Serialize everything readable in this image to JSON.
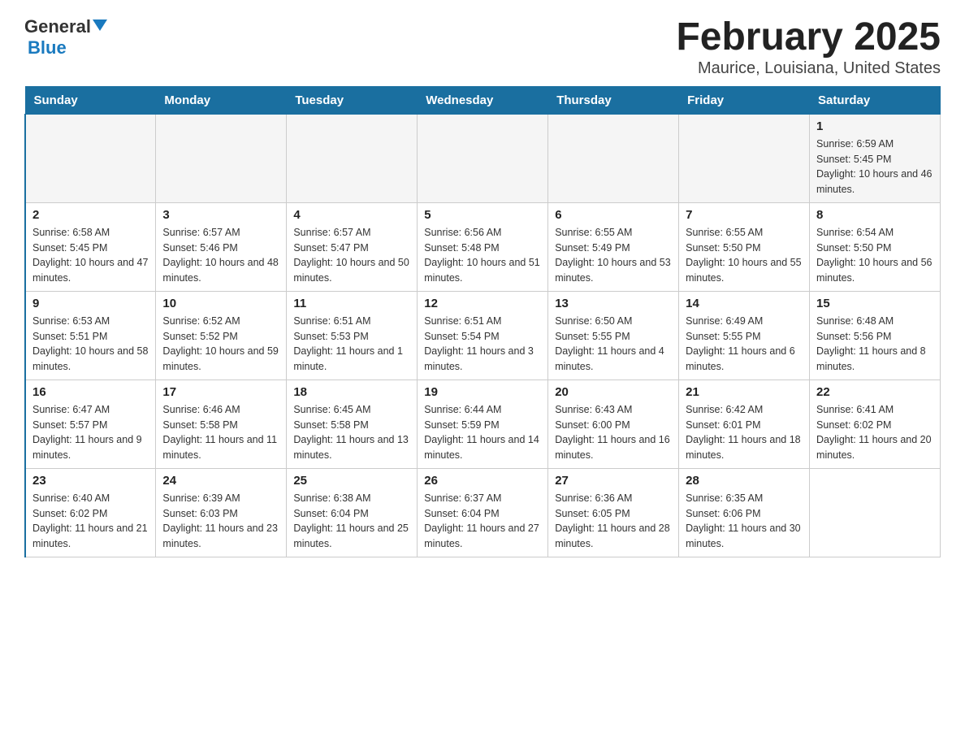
{
  "header": {
    "logo_general": "General",
    "logo_blue": "Blue",
    "title": "February 2025",
    "subtitle": "Maurice, Louisiana, United States"
  },
  "days_of_week": [
    "Sunday",
    "Monday",
    "Tuesday",
    "Wednesday",
    "Thursday",
    "Friday",
    "Saturday"
  ],
  "weeks": [
    [
      {
        "day": "",
        "detail": ""
      },
      {
        "day": "",
        "detail": ""
      },
      {
        "day": "",
        "detail": ""
      },
      {
        "day": "",
        "detail": ""
      },
      {
        "day": "",
        "detail": ""
      },
      {
        "day": "",
        "detail": ""
      },
      {
        "day": "1",
        "detail": "Sunrise: 6:59 AM\nSunset: 5:45 PM\nDaylight: 10 hours and 46 minutes."
      }
    ],
    [
      {
        "day": "2",
        "detail": "Sunrise: 6:58 AM\nSunset: 5:45 PM\nDaylight: 10 hours and 47 minutes."
      },
      {
        "day": "3",
        "detail": "Sunrise: 6:57 AM\nSunset: 5:46 PM\nDaylight: 10 hours and 48 minutes."
      },
      {
        "day": "4",
        "detail": "Sunrise: 6:57 AM\nSunset: 5:47 PM\nDaylight: 10 hours and 50 minutes."
      },
      {
        "day": "5",
        "detail": "Sunrise: 6:56 AM\nSunset: 5:48 PM\nDaylight: 10 hours and 51 minutes."
      },
      {
        "day": "6",
        "detail": "Sunrise: 6:55 AM\nSunset: 5:49 PM\nDaylight: 10 hours and 53 minutes."
      },
      {
        "day": "7",
        "detail": "Sunrise: 6:55 AM\nSunset: 5:50 PM\nDaylight: 10 hours and 55 minutes."
      },
      {
        "day": "8",
        "detail": "Sunrise: 6:54 AM\nSunset: 5:50 PM\nDaylight: 10 hours and 56 minutes."
      }
    ],
    [
      {
        "day": "9",
        "detail": "Sunrise: 6:53 AM\nSunset: 5:51 PM\nDaylight: 10 hours and 58 minutes."
      },
      {
        "day": "10",
        "detail": "Sunrise: 6:52 AM\nSunset: 5:52 PM\nDaylight: 10 hours and 59 minutes."
      },
      {
        "day": "11",
        "detail": "Sunrise: 6:51 AM\nSunset: 5:53 PM\nDaylight: 11 hours and 1 minute."
      },
      {
        "day": "12",
        "detail": "Sunrise: 6:51 AM\nSunset: 5:54 PM\nDaylight: 11 hours and 3 minutes."
      },
      {
        "day": "13",
        "detail": "Sunrise: 6:50 AM\nSunset: 5:55 PM\nDaylight: 11 hours and 4 minutes."
      },
      {
        "day": "14",
        "detail": "Sunrise: 6:49 AM\nSunset: 5:55 PM\nDaylight: 11 hours and 6 minutes."
      },
      {
        "day": "15",
        "detail": "Sunrise: 6:48 AM\nSunset: 5:56 PM\nDaylight: 11 hours and 8 minutes."
      }
    ],
    [
      {
        "day": "16",
        "detail": "Sunrise: 6:47 AM\nSunset: 5:57 PM\nDaylight: 11 hours and 9 minutes."
      },
      {
        "day": "17",
        "detail": "Sunrise: 6:46 AM\nSunset: 5:58 PM\nDaylight: 11 hours and 11 minutes."
      },
      {
        "day": "18",
        "detail": "Sunrise: 6:45 AM\nSunset: 5:58 PM\nDaylight: 11 hours and 13 minutes."
      },
      {
        "day": "19",
        "detail": "Sunrise: 6:44 AM\nSunset: 5:59 PM\nDaylight: 11 hours and 14 minutes."
      },
      {
        "day": "20",
        "detail": "Sunrise: 6:43 AM\nSunset: 6:00 PM\nDaylight: 11 hours and 16 minutes."
      },
      {
        "day": "21",
        "detail": "Sunrise: 6:42 AM\nSunset: 6:01 PM\nDaylight: 11 hours and 18 minutes."
      },
      {
        "day": "22",
        "detail": "Sunrise: 6:41 AM\nSunset: 6:02 PM\nDaylight: 11 hours and 20 minutes."
      }
    ],
    [
      {
        "day": "23",
        "detail": "Sunrise: 6:40 AM\nSunset: 6:02 PM\nDaylight: 11 hours and 21 minutes."
      },
      {
        "day": "24",
        "detail": "Sunrise: 6:39 AM\nSunset: 6:03 PM\nDaylight: 11 hours and 23 minutes."
      },
      {
        "day": "25",
        "detail": "Sunrise: 6:38 AM\nSunset: 6:04 PM\nDaylight: 11 hours and 25 minutes."
      },
      {
        "day": "26",
        "detail": "Sunrise: 6:37 AM\nSunset: 6:04 PM\nDaylight: 11 hours and 27 minutes."
      },
      {
        "day": "27",
        "detail": "Sunrise: 6:36 AM\nSunset: 6:05 PM\nDaylight: 11 hours and 28 minutes."
      },
      {
        "day": "28",
        "detail": "Sunrise: 6:35 AM\nSunset: 6:06 PM\nDaylight: 11 hours and 30 minutes."
      },
      {
        "day": "",
        "detail": ""
      }
    ]
  ]
}
